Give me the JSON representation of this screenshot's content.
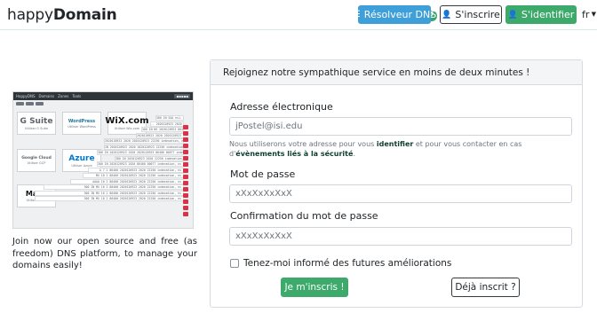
{
  "header": {
    "brand_prefix": "happy",
    "brand_suffix": "Domain",
    "help_symbol": "?",
    "resolver_label": "Résolveur DNS",
    "signup_label": "S'inscrire",
    "login_label": "S'identifier",
    "language": "fr"
  },
  "preview": {
    "app_title": "HappyDNS",
    "menu_items": [
      "Domains",
      "Zones",
      "Tools"
    ],
    "logos": [
      {
        "name": "G Suite",
        "sub": "Utiliser G Suite"
      },
      {
        "name": "WordPress",
        "sub": "Utiliser WordPress"
      },
      {
        "name": "WiX.com",
        "sub": "Utiliser Wix.com"
      },
      {
        "name": "Google Cloud",
        "sub": "Utiliser GCP"
      },
      {
        "name": "Azure",
        "sub": "Utiliser Azure"
      },
      {
        "name": "Mailo",
        "sub": "Utiliser Mailo"
      }
    ],
    "code_lines": [
      "300 IN SOA ns1.",
      ".. 2020120923 2020 00077 indexation, ns",
      "300 IN NS 2020120923 86400 00077 indexation, ns",
      "2020120923 2020 2020120923 22250 indexation, ns",
      "2020120923 2020 2020120923 22250 indexation, ns",
      "IN 2020120923 2020 2020120923 22250 indexation, ns",
      "300 IN 2020120923 2020 2020120923 86400 00077 indexation",
      "300 IN 2020120923 2020 22250 indexation, ns",
      "300 IN 2020120923 2020 86400 00077 indexation, ns",
      "A 7 2 86400 2020120923 2020 22250 indexation, ns",
      "MX 10 2 86400 2020120923 2020 22250 indexation, ns",
      "AAAA 10 2 86400 2020120923 2020 22250 indexation, ns",
      "300 IN MX 10 2 86400 2020120923 2020 22250 indexation, ns",
      "300 IN MX 10 2 86400 2020120923 2020 22250 indexation, ns",
      "300 IN MX 10 2 86400 2020120923 2020 22250 indexation, ns"
    ]
  },
  "intro": {
    "text": "Join now our open source and free (as freedom) DNS platform, to manage your domains easily!"
  },
  "signup": {
    "title": "Rejoignez notre sympathique service en moins de deux minutes !",
    "email_label": "Adresse électronique",
    "email_placeholder": "jPostel@isi.edu",
    "email_help_before": "Nous utiliserons votre adresse pour vous ",
    "email_help_identify": "identifier",
    "email_help_middle": " et pour vous contacter en cas d'",
    "email_help_events": "évènements liés à la sécurité",
    "email_help_after": ".",
    "password_label": "Mot de passe",
    "password_placeholder": "xXxXxXxXxX",
    "confirm_label": "Confirmation du mot de passe",
    "confirm_placeholder": "xXxXxXxXxX",
    "newsletter_label": "Tenez-moi informé des futures améliorations",
    "submit_label": "Je m'inscris !",
    "already_label": "Déjà inscrit ?"
  }
}
